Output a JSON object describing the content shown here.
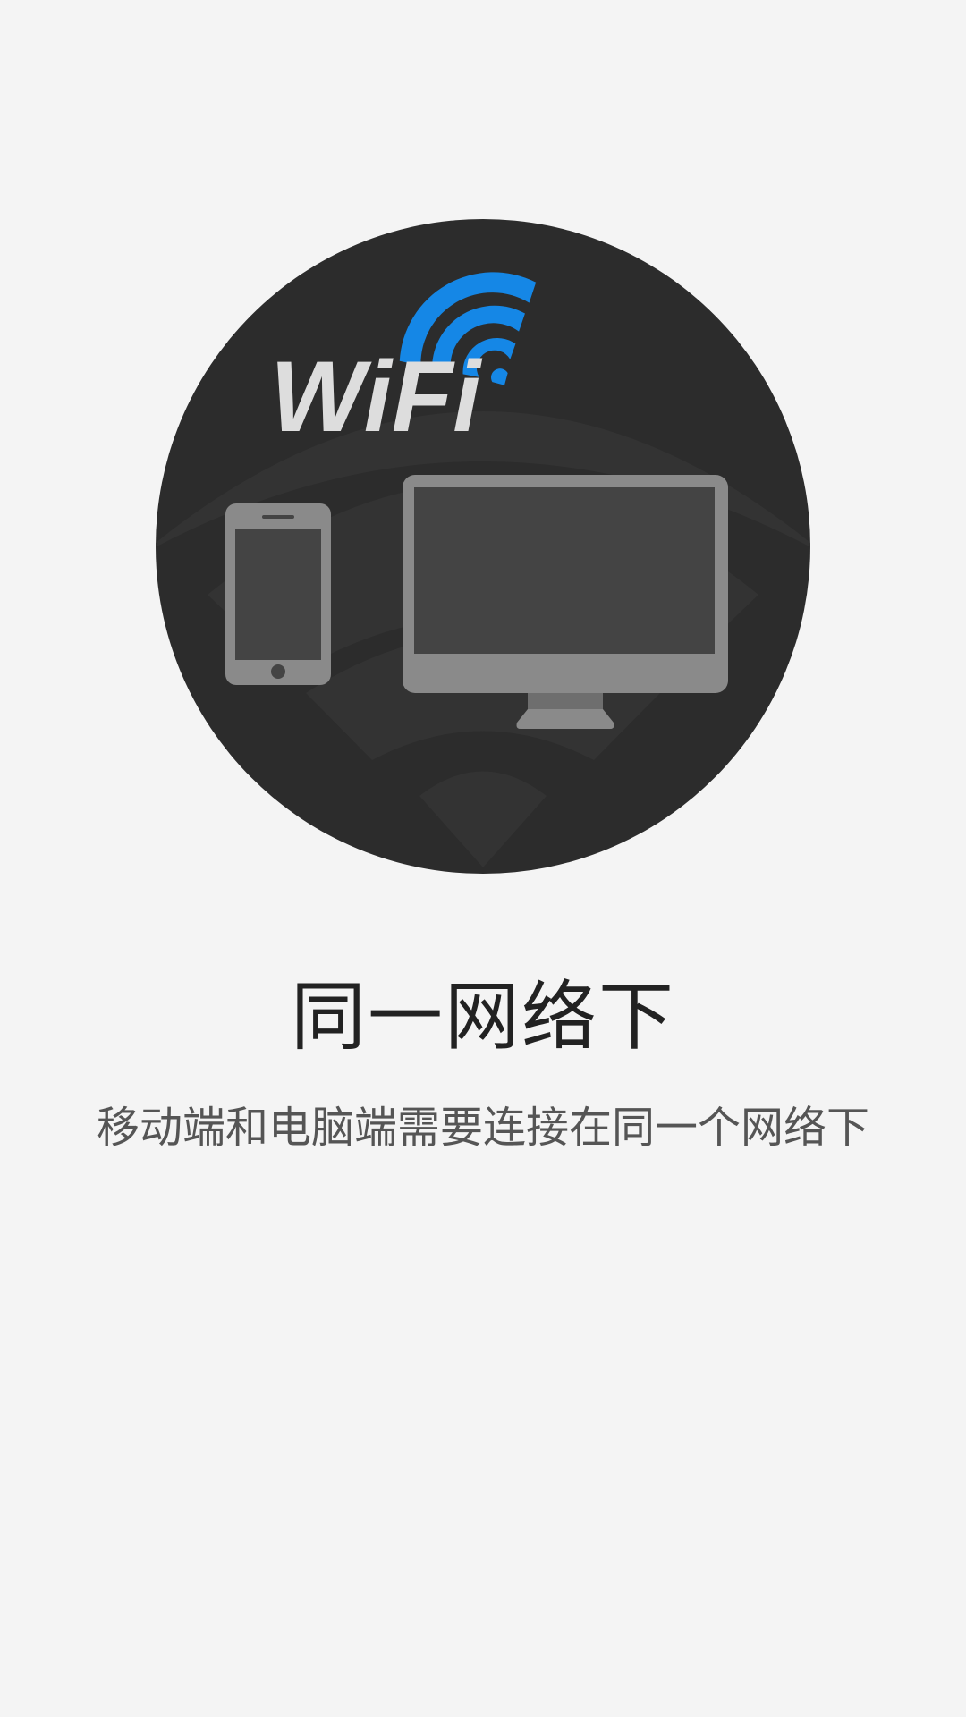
{
  "illustration": {
    "logo_text": "WiFi",
    "accent_color": "#1587e6",
    "circle_color": "#2c2c2c",
    "device_color": "#8a8a8a",
    "screen_color": "#444444"
  },
  "content": {
    "title": "同一网络下",
    "subtitle": "移动端和电脑端需要连接在同一个网络下"
  }
}
